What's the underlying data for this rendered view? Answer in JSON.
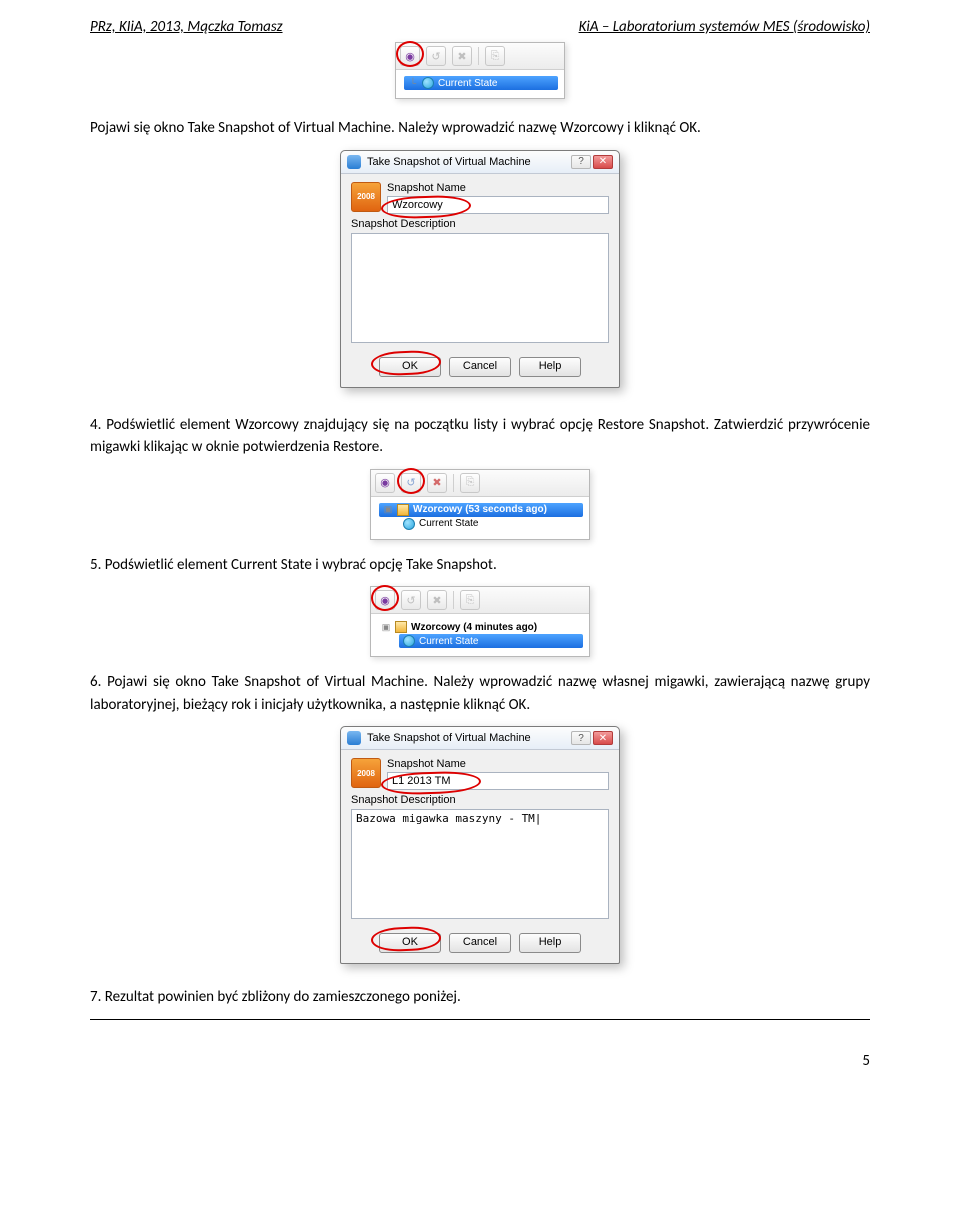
{
  "header": {
    "left": "PRz, KIiA, 2013, Mączka Tomasz",
    "right": "KiA – Laboratorium systemów MES (środowisko)"
  },
  "fig1": {
    "current_state": "Current State"
  },
  "p1": "Pojawi się okno Take Snapshot of Virtual Machine. Należy wprowadzić  nazwę Wzorcowy i kliknąć OK.",
  "dlg1": {
    "title": "Take Snapshot of Virtual Machine",
    "logo_year": "2008",
    "label_name": "Snapshot Name",
    "name_value": "Wzorcowy",
    "label_desc": "Snapshot Description",
    "desc_value": "",
    "ok": "OK",
    "cancel": "Cancel",
    "help": "Help"
  },
  "p4_num": "4.",
  "p4": "Podświetlić element Wzorcowy znajdujący się na początku listy i wybrać opcję Restore Snapshot. Zatwierdzić przywrócenie migawki klikając w oknie potwierdzenia Restore.",
  "fig3": {
    "item1": "Wzorcowy (53 seconds ago)",
    "item2": "Current State"
  },
  "p5_num": "5.",
  "p5": "Podświetlić element Current State i wybrać opcję Take Snapshot.",
  "fig4": {
    "item1": "Wzorcowy (4 minutes ago)",
    "item2": "Current State"
  },
  "p6_num": "6.",
  "p6": "Pojawi się okno Take Snapshot of Virtual Machine. Należy wprowadzić nazwę własnej migawki, zawierającą nazwę grupy laboratoryjnej, bieżący rok i inicjały użytkownika, a następnie kliknąć OK.",
  "dlg2": {
    "title": "Take Snapshot of Virtual Machine",
    "logo_year": "2008",
    "label_name": "Snapshot Name",
    "name_value": "L1 2013 TM",
    "label_desc": "Snapshot Description",
    "desc_value": "Bazowa migawka maszyny - TM|",
    "ok": "OK",
    "cancel": "Cancel",
    "help": "Help"
  },
  "p7_num": "7.",
  "p7": "Rezultat powinien być zbliżony do zamieszczonego poniżej.",
  "page_number": "5"
}
